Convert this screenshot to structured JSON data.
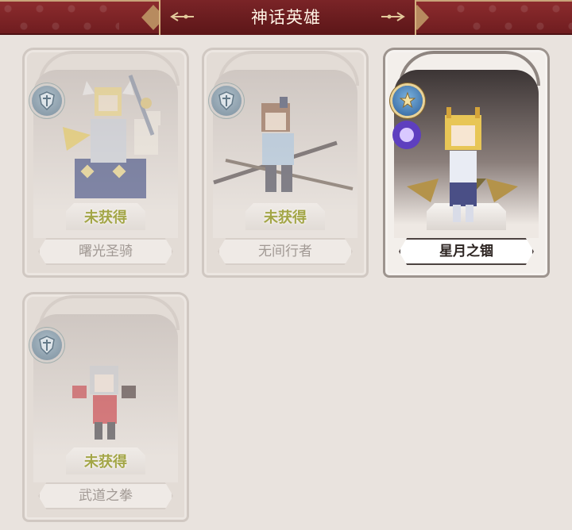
{
  "header": {
    "title": "神话英雄"
  },
  "heroes": [
    {
      "name": "曙光圣骑",
      "status": "未获得",
      "owned": false,
      "emblem": "shield-emblem-icon",
      "figure": "knight-on-horse"
    },
    {
      "name": "无间行者",
      "status": "未获得",
      "owned": false,
      "emblem": "shield-emblem-icon",
      "figure": "spear-warrior"
    },
    {
      "name": "星月之锢",
      "status": "",
      "owned": true,
      "emblem": "star-emblem-icon",
      "figure": "golden-mage"
    },
    {
      "name": "武道之拳",
      "status": "未获得",
      "owned": false,
      "emblem": "shield-emblem-icon",
      "figure": "martial-girl"
    }
  ],
  "colors": {
    "banner": "#7a2427",
    "locked_text": "#a3a647",
    "background": "#e9e3de"
  }
}
